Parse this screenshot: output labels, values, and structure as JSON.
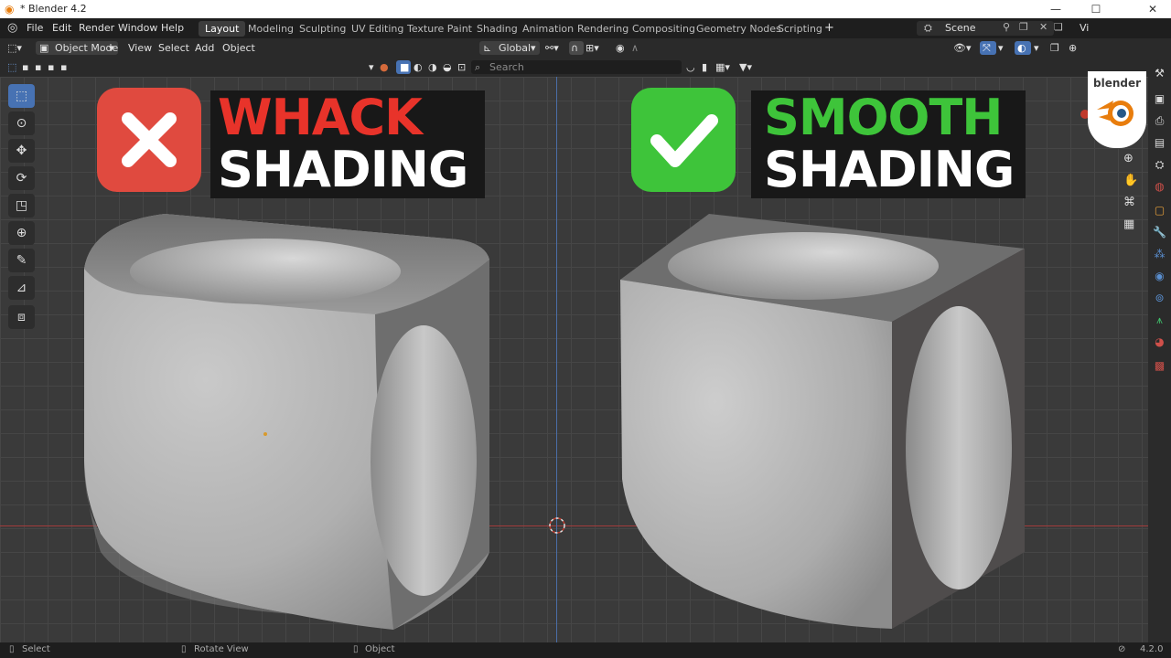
{
  "window": {
    "title": "* Blender 4.2",
    "minimize": "—",
    "maximize": "☐",
    "close": "✕"
  },
  "menu": [
    "File",
    "Edit",
    "Render",
    "Window",
    "Help"
  ],
  "workspaces": [
    "Layout",
    "Modeling",
    "Sculpting",
    "UV Editing",
    "Texture Paint",
    "Shading",
    "Animation",
    "Rendering",
    "Compositing",
    "Geometry Nodes",
    "Scripting"
  ],
  "active_workspace": "Layout",
  "add_workspace": "+",
  "scene": {
    "label": "Scene",
    "view_layer": "Vi"
  },
  "header": {
    "mode": "Object Mode",
    "menus": [
      "View",
      "Select",
      "Add",
      "Object"
    ],
    "transform_orientation": "Global",
    "search_placeholder": "Search"
  },
  "overlay": {
    "left_title_1": "WHACK",
    "left_title_2": "SHADING",
    "right_title_1": "SMOOTH",
    "right_title_2": "SHADING",
    "left_title_1_color": "#e8332a",
    "right_title_1_color": "#3ec43a",
    "bad_icon": "cross-mark-icon",
    "good_icon": "check-mark-icon"
  },
  "logo": {
    "word": "blender"
  },
  "status": {
    "select": "Select",
    "rotate": "Rotate View",
    "object": "Object",
    "version": "4.2.0"
  },
  "colors": {
    "accent": "#4772b3",
    "x_axis": "#a33b3b",
    "y_axis": "#4a6ea8"
  }
}
